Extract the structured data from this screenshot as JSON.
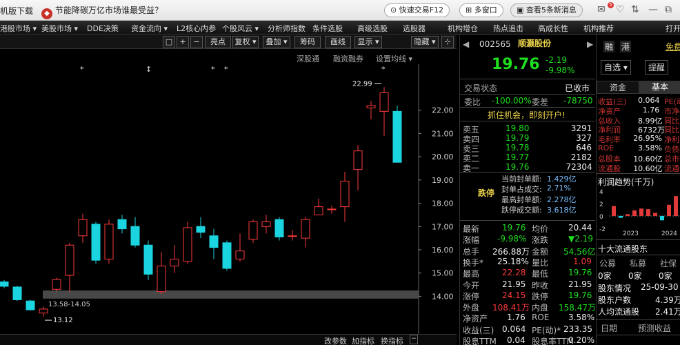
{
  "topbar": {
    "download": "机版下载",
    "news": "节能降碳万亿市场谁最受益？",
    "news_icon": "flame-icon",
    "quick_trade": "快速交易F12",
    "multi_window": "多窗口",
    "messages": "查看5条新消息",
    "msg_badge": "5"
  },
  "menu": [
    "港股市场 ▾",
    "美股市场 ▾",
    "DDE决策",
    "资金流向 ▾",
    "L2核心内参",
    "个股风云 ▾",
    "分析师指数",
    "条件选股",
    "高级选股",
    "选股器",
    "机构增仓",
    "热点追击",
    "高成长性",
    "机构推荐",
    "打开"
  ],
  "chart_toolbar": {
    "buttons": [
      "□",
      "+",
      "−",
      "亮点",
      "复权 ▾",
      "叠加 ▾",
      "筹码",
      "画线",
      "显示 ▾",
      "隐藏 ▾"
    ],
    "sub": [
      "深股通",
      "融资融券",
      "设置均线 ▾"
    ]
  },
  "chart_data": {
    "type": "candlestick",
    "ylim": [
      13.3,
      23.8
    ],
    "yticks": [
      "22.00",
      "21.00",
      "20.00",
      "19.00",
      "18.00",
      "17.00",
      "16.00",
      "15.00",
      "14.00"
    ],
    "candles": [
      {
        "o": 14.62,
        "c": 14.43,
        "h": 14.7,
        "l": 14.35
      },
      {
        "o": 14.4,
        "c": 13.85,
        "h": 14.45,
        "l": 13.8
      },
      {
        "o": 13.8,
        "c": 13.42,
        "h": 13.85,
        "l": 13.38
      },
      {
        "o": 13.28,
        "c": 13.45,
        "h": 13.55,
        "l": 13.12
      },
      {
        "o": 14.3,
        "c": 14.72,
        "h": 14.8,
        "l": 14.2
      },
      {
        "o": 14.9,
        "c": 16.2,
        "h": 16.3,
        "l": 14.2
      },
      {
        "o": 16.6,
        "c": 17.3,
        "h": 17.55,
        "l": 16.3
      },
      {
        "o": 17.1,
        "c": 15.55,
        "h": 17.2,
        "l": 15.4
      },
      {
        "o": 15.6,
        "c": 17.1,
        "h": 17.3,
        "l": 15.4
      },
      {
        "o": 17.3,
        "c": 16.9,
        "h": 17.5,
        "l": 16.7
      },
      {
        "o": 17.0,
        "c": 16.2,
        "h": 17.4,
        "l": 16.1
      },
      {
        "o": 16.2,
        "c": 14.95,
        "h": 16.4,
        "l": 14.7
      },
      {
        "o": 14.2,
        "c": 15.3,
        "h": 15.9,
        "l": 14.1
      },
      {
        "o": 15.3,
        "c": 15.6,
        "h": 16.2,
        "l": 15.0
      },
      {
        "o": 15.5,
        "c": 16.95,
        "h": 17.2,
        "l": 15.4
      },
      {
        "o": 17.0,
        "c": 16.75,
        "h": 17.4,
        "l": 16.5
      },
      {
        "o": 16.6,
        "c": 16.1,
        "h": 16.9,
        "l": 15.6
      },
      {
        "o": 16.3,
        "c": 15.2,
        "h": 16.4,
        "l": 15.1
      },
      {
        "o": 15.6,
        "c": 15.95,
        "h": 16.7,
        "l": 15.5
      },
      {
        "o": 16.45,
        "c": 17.2,
        "h": 17.3,
        "l": 16.3
      },
      {
        "o": 17.0,
        "c": 17.2,
        "h": 17.5,
        "l": 16.7
      },
      {
        "o": 17.3,
        "c": 16.55,
        "h": 17.4,
        "l": 16.4
      },
      {
        "o": 16.6,
        "c": 16.6,
        "h": 16.85,
        "l": 16.4
      },
      {
        "o": 16.5,
        "c": 17.3,
        "h": 17.4,
        "l": 16.1
      },
      {
        "o": 17.5,
        "c": 17.85,
        "h": 18.2,
        "l": 17.5
      },
      {
        "o": 17.75,
        "c": 17.75,
        "h": 17.9,
        "l": 17.55
      },
      {
        "o": 17.85,
        "c": 18.95,
        "h": 19.35,
        "l": 17.2
      },
      {
        "o": 19.45,
        "c": 20.25,
        "h": 20.5,
        "l": 18.55
      },
      {
        "o": 22.1,
        "c": 22.2,
        "h": 22.4,
        "l": 21.6
      },
      {
        "o": 21.95,
        "c": 22.75,
        "h": 22.99,
        "l": 20.9
      },
      {
        "o": 21.95,
        "c": 19.76,
        "h": 22.2,
        "l": 19.76
      }
    ],
    "high_label": "22.99",
    "low_label": "13.12",
    "range_label": "13.58-14.05",
    "range_zone": [
      13.9,
      14.25
    ],
    "markers": [
      "*",
      "↕",
      "*",
      "*",
      "*"
    ]
  },
  "chart_bottom": [
    "改参数",
    "加指标",
    "换指标"
  ],
  "quote": {
    "code": "002565",
    "name": "顺灏股份",
    "price": "19.76",
    "change": "-2.19",
    "change_pct": "-9.98%",
    "trade_status_label": "交易状态",
    "trade_status": "已收市",
    "weibi_label": "委比",
    "weibi": "-100.00%",
    "weicha_label": "委差",
    "weicha": "-78750",
    "promo": "抓住机会，即刻开户!",
    "asks": [
      {
        "label": "卖五",
        "price": "19.80",
        "vol": "3291"
      },
      {
        "label": "卖四",
        "price": "19.79",
        "vol": "327"
      },
      {
        "label": "卖三",
        "price": "19.78",
        "vol": "646"
      },
      {
        "label": "卖二",
        "price": "19.77",
        "vol": "2182"
      },
      {
        "label": "卖一",
        "price": "19.76",
        "vol": "72304"
      }
    ],
    "limit_label": "跌停",
    "limit_rows": [
      {
        "label": "当前封单额:",
        "value": "1.429亿"
      },
      {
        "label": "封单占成交:",
        "value": "2.71%"
      },
      {
        "label": "最高封单额:",
        "value": "2.278亿"
      },
      {
        "label": "跌停成交额:",
        "value": "3.618亿"
      }
    ],
    "stats": [
      [
        "最新",
        "19.76",
        "均价",
        "20.44"
      ],
      [
        "涨幅",
        "-9.98%",
        "涨跌",
        "▼2.19"
      ],
      [
        "总手",
        "266.88万",
        "金额",
        "54.56亿"
      ],
      [
        "换手*",
        "25.18%",
        "量比",
        "1.09"
      ],
      [
        "最高",
        "22.28",
        "最低",
        "19.76"
      ],
      [
        "今开",
        "21.95",
        "昨收",
        "21.95"
      ],
      [
        "涨停",
        "24.15",
        "跌停",
        "19.76"
      ],
      [
        "外盘",
        "108.41万",
        "内盘",
        "158.47万"
      ],
      [
        "净资产",
        "1.76",
        "ROE",
        "3.58%"
      ],
      [
        "收益(三)",
        "0.064",
        "PE(动)*",
        "233.35"
      ],
      [
        "股息TTM",
        "0.04",
        "股息率TTM",
        "0.20%"
      ]
    ]
  },
  "right": {
    "code_short": "融",
    "hk": "港",
    "free": "免费",
    "self_select": "自选 ▾",
    "remind": "提醒",
    "tabs": [
      "资金",
      "基本"
    ],
    "fundamentals": [
      [
        "收益(三)",
        "0.064",
        "PE(动)"
      ],
      [
        "净资产",
        "1.76",
        "市净率"
      ],
      [
        "总收入",
        "8.99亿",
        "同比"
      ],
      [
        "净利润",
        "6732万",
        "同比"
      ],
      [
        "毛利率",
        "26.95%",
        "净利率"
      ],
      [
        "ROE",
        "3.58%",
        "负债率"
      ],
      [
        "总股本",
        "10.60亿",
        "总市值"
      ],
      [
        "流通股",
        "10.60亿",
        "流通值"
      ]
    ],
    "profit_title": "利润趋势(千万)",
    "profit_yticks": [
      "4",
      "2",
      "0",
      "-2"
    ],
    "profit_bars": [
      1.6,
      -0.3,
      0.3,
      0.9,
      1.2,
      1.1,
      0.5,
      -0.7,
      1.8,
      3.2
    ],
    "profit_years": [
      "2023",
      "2024"
    ],
    "holders_title": "十大流通股东",
    "holders_head": [
      "公募",
      "私募",
      "社保"
    ],
    "holders_vals": [
      "0家",
      "0家",
      "0家"
    ],
    "info": [
      [
        "股东情况",
        "25-09-30"
      ],
      [
        "股东户数",
        "4.39万"
      ],
      [
        "人均流通股",
        "2.41万"
      ]
    ],
    "bottom_head": [
      "日期",
      "预测收益"
    ]
  },
  "colors": {
    "up": "#ff3b3b",
    "down": "#1ad5e0",
    "accent": "#e8d04a"
  }
}
